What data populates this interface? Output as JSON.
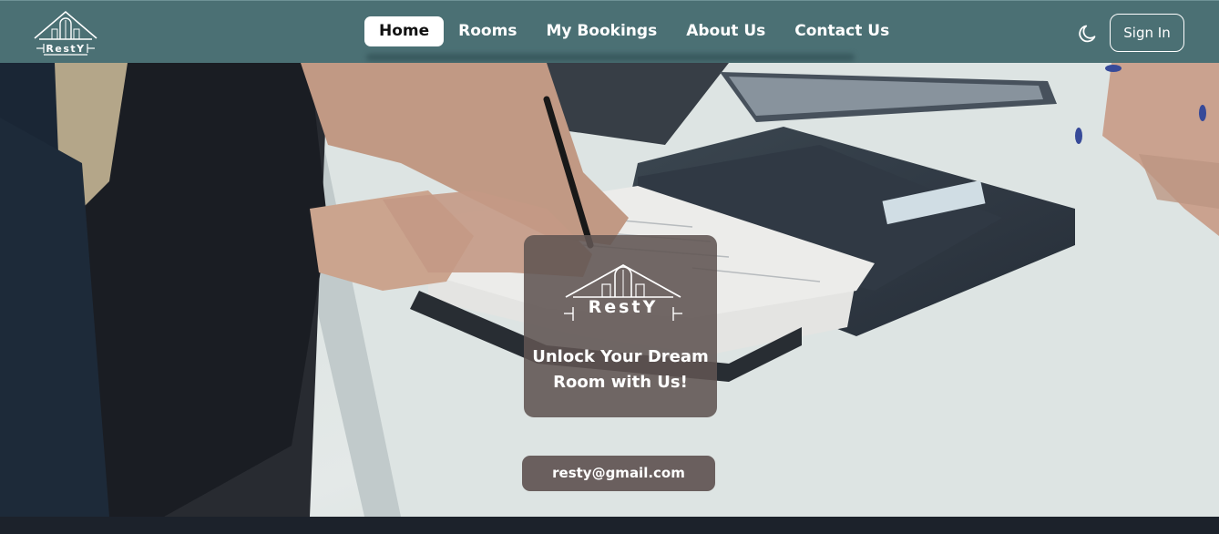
{
  "navbar": {
    "brand": "RestY",
    "links": [
      {
        "label": "Home",
        "active": true
      },
      {
        "label": "Rooms",
        "active": false
      },
      {
        "label": "My Bookings",
        "active": false
      },
      {
        "label": "About Us",
        "active": false
      },
      {
        "label": "Contact Us",
        "active": false
      }
    ],
    "theme_icon": "moon-icon",
    "signin_label": "Sign In"
  },
  "hero": {
    "brand": "RestY",
    "tagline": "Unlock Your Dream Room with Us!",
    "email": "resty@gmail.com"
  },
  "colors": {
    "navbar_bg": "#4b7074",
    "card_bg": "#605452",
    "footer_bg": "#1c222b",
    "active_link_bg": "#ffffff"
  }
}
